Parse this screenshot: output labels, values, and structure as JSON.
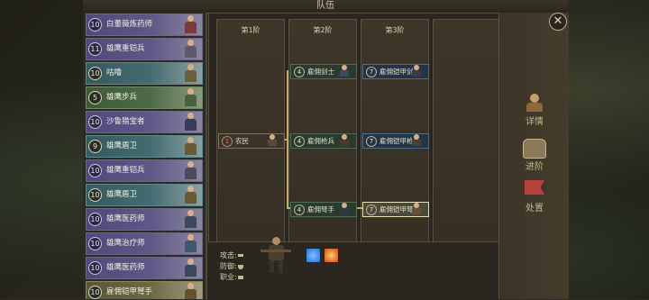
{
  "window": {
    "title": "队伍",
    "close_glyph": "✕"
  },
  "units": [
    {
      "level": "10",
      "name": "白董薇炼药师",
      "tone": "purple"
    },
    {
      "level": "11",
      "name": "雄鹰重铠兵",
      "tone": "purple"
    },
    {
      "level": "10",
      "name": "咕噜",
      "tone": "teal"
    },
    {
      "level": "5",
      "name": "雄鹰步兵",
      "tone": "green"
    },
    {
      "level": "10",
      "name": "沙鲁猎宝者",
      "tone": "purple"
    },
    {
      "level": "9",
      "name": "雄鹰盾卫",
      "tone": "teal"
    },
    {
      "level": "10",
      "name": "雄鹰重铠兵",
      "tone": "purple"
    },
    {
      "level": "10",
      "name": "雄鹰盾卫",
      "tone": "teal"
    },
    {
      "level": "10",
      "name": "雄鹰医药师",
      "tone": "purple"
    },
    {
      "level": "10",
      "name": "雄鹰治疗师",
      "tone": "purple"
    },
    {
      "level": "10",
      "name": "雄鹰医药师",
      "tone": "purple"
    },
    {
      "level": "10",
      "name": "雇佣铠甲弩手",
      "tone": "olive"
    }
  ],
  "tiers": [
    "第1阶",
    "第2阶",
    "第3阶"
  ],
  "tree": {
    "tier1": [
      {
        "level": "1",
        "name": "农民"
      }
    ],
    "tier2": [
      {
        "level": "4",
        "name": "雇佣剑士"
      },
      {
        "level": "4",
        "name": "雇佣枪兵"
      },
      {
        "level": "4",
        "name": "雇佣弩手"
      }
    ],
    "tier3": [
      {
        "level": "7",
        "name": "雇佣铠甲剑士"
      },
      {
        "level": "7",
        "name": "雇佣铠甲枪兵"
      },
      {
        "level": "7",
        "name": "雇佣铠甲弩手"
      }
    ]
  },
  "info": {
    "attack_label": "攻击:",
    "defense_label": "防御:",
    "class_label": "职业:"
  },
  "skills": [
    {
      "icon": "ice-skill-icon",
      "color": "#2a6fd1"
    },
    {
      "icon": "fire-skill-icon",
      "color": "#d14a1a"
    }
  ],
  "actions": [
    {
      "label": "详情",
      "icon": "portrait-icon"
    },
    {
      "label": "进阶",
      "icon": "armor-icon"
    },
    {
      "label": "处置",
      "icon": "banner-icon"
    }
  ]
}
